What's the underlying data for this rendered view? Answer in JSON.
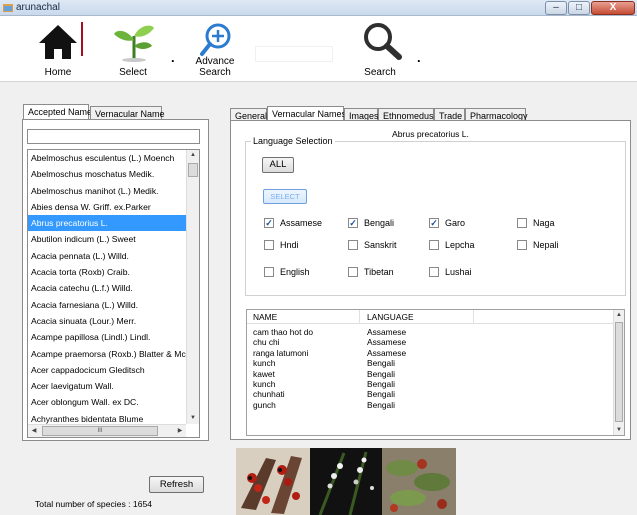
{
  "window": {
    "title": "arunachal",
    "close_glyph": "X"
  },
  "toolbar": {
    "home_label": "Home",
    "select_label": "Select",
    "advance_search_label": "Advance Search",
    "search_label": "Search",
    "dropdown_dot": "."
  },
  "left_panel": {
    "tabs": [
      "Accepted Name",
      "Vernacular Name"
    ],
    "search_value": "",
    "items": [
      "Abelmoschus esculentus (L.) Moench",
      "Abelmoschus moschatus Medik.",
      "Abelmoschus manihot (L.) Medik.",
      "Abies densa W. Griff. ex.Parker",
      "Abrus precatorius L.",
      "Abutilon indicum (L.) Sweet",
      "Acacia pennata (L.) Willd.",
      "Acacia torta (Roxb) Craib.",
      "Acacia catechu (L.f.) Willd.",
      "Acacia farnesiana (L.) Willd.",
      "Acacia sinuata (Lour.) Merr.",
      "Acampe papillosa (Lindl.) Lindl.",
      "Acampe praemorsa (Roxb.) Blatter & McC.",
      "Acer cappadocicum Gleditsch",
      "Acer laevigatum Wall.",
      "Acer oblongum Wall. ex DC.",
      "Achyranthes bidentata Blume"
    ],
    "selected_index": 4,
    "refresh_label": "Refresh",
    "total_label": "Total number of species : 1654",
    "hscroll_thumb": "III"
  },
  "right_panel": {
    "tabs": [
      "General",
      "Vernacular Names",
      "Images",
      "Ethnomeduse",
      "Trade",
      "Pharmacology"
    ],
    "active_tab": 1,
    "species_title": "Abrus precatorius L.",
    "language_group_title": "Language Selection",
    "all_button": "ALL",
    "select_button": "SELECT",
    "languages": [
      {
        "label": "Assamese",
        "checked": true
      },
      {
        "label": "Bengali",
        "checked": true
      },
      {
        "label": "Garo",
        "checked": true
      },
      {
        "label": "Naga",
        "checked": false
      },
      {
        "label": "Hndi",
        "checked": false
      },
      {
        "label": "Sanskrit",
        "checked": false
      },
      {
        "label": "Lepcha",
        "checked": false
      },
      {
        "label": "Nepali",
        "checked": false
      },
      {
        "label": "English",
        "checked": false
      },
      {
        "label": "Tibetan",
        "checked": false
      },
      {
        "label": "Lushai",
        "checked": false
      }
    ],
    "grid": {
      "columns": [
        "NAME",
        "LANGUAGE"
      ],
      "rows": [
        [
          "cam thao hot do",
          "Assamese"
        ],
        [
          "chu chi",
          "Assamese"
        ],
        [
          "ranga latumoni",
          "Assamese"
        ],
        [
          "kunch",
          "Bengali"
        ],
        [
          "kawet",
          "Bengali"
        ],
        [
          "kunch",
          "Bengali"
        ],
        [
          "chunhati",
          "Bengali"
        ],
        [
          "gunch",
          "Bengali"
        ]
      ]
    }
  },
  "colors": {
    "selection": "#3399ff",
    "home_icon": "#111111",
    "select_icon": "#5ca033",
    "adv_search_icon": "#2b7bd0"
  }
}
